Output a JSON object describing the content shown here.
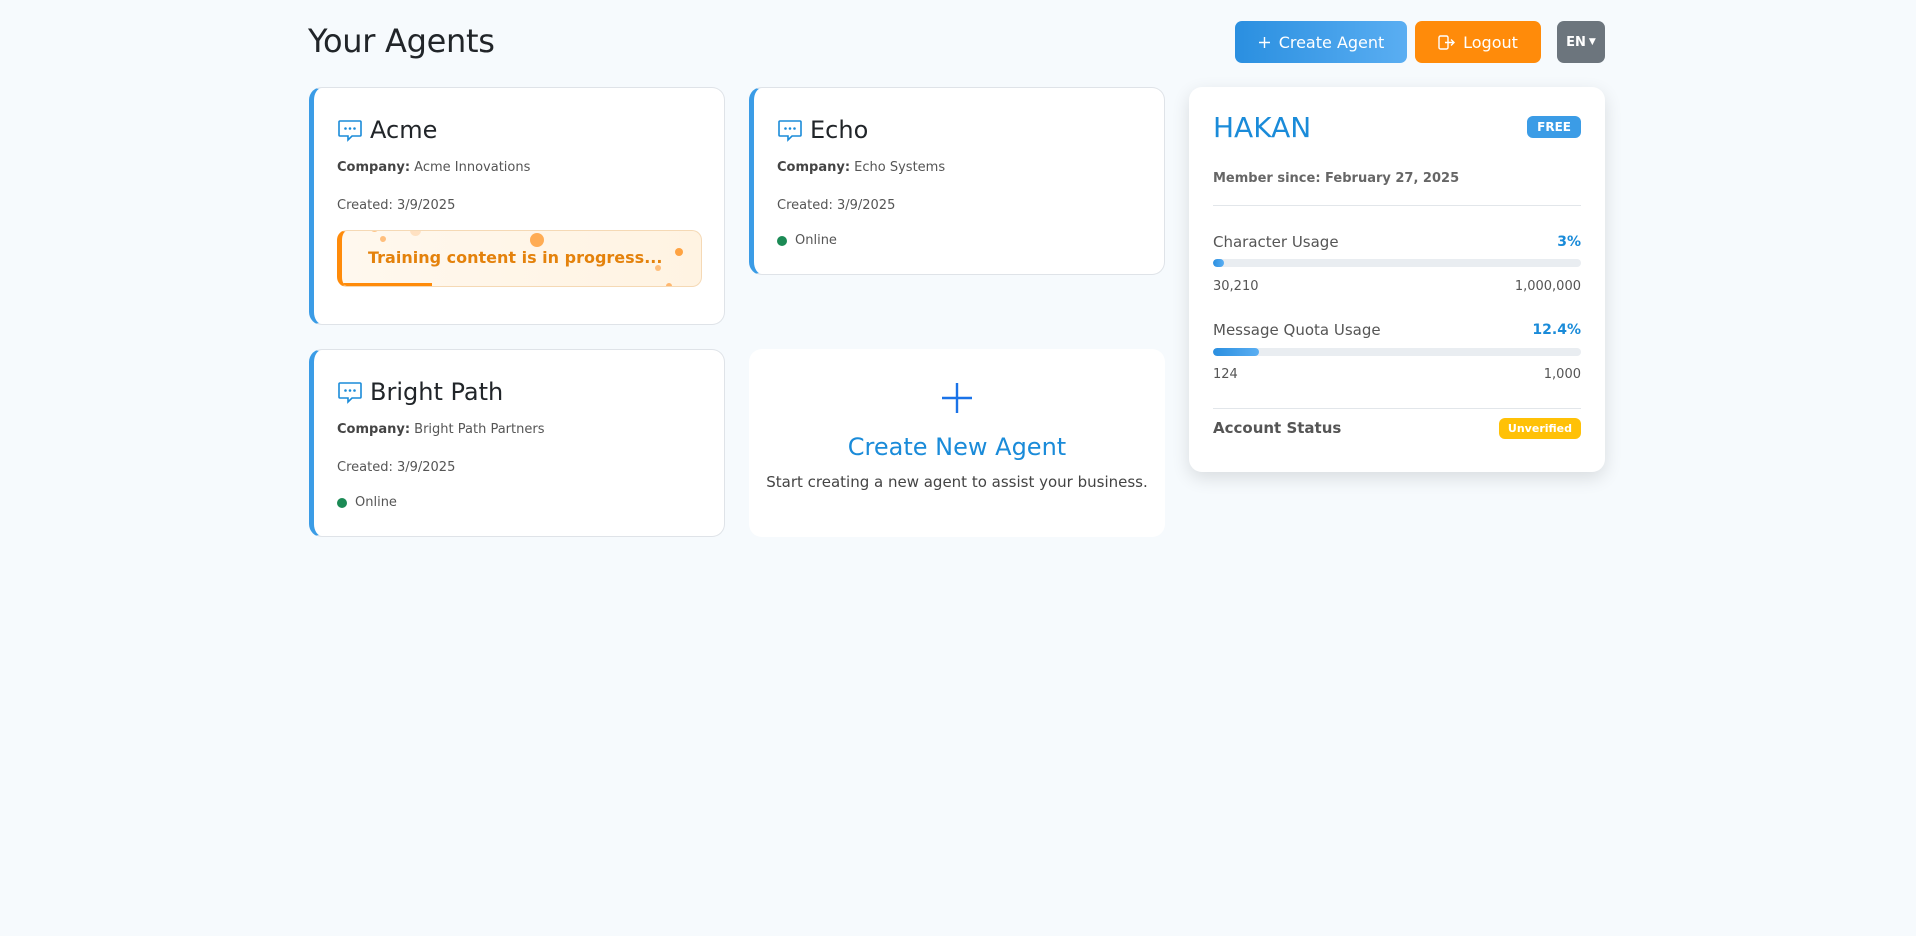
{
  "header": {
    "title": "Your Agents",
    "create_label": "Create Agent",
    "logout_label": "Logout",
    "language": "EN"
  },
  "agents": [
    {
      "name": "Acme",
      "company_label": "Company:",
      "company": "Acme Innovations",
      "created": "Created: 3/9/2025",
      "training_text": "Training content is in progress...",
      "training_progress": 0.25
    },
    {
      "name": "Echo",
      "company_label": "Company:",
      "company": "Echo Systems",
      "created": "Created: 3/9/2025",
      "status": "Online"
    },
    {
      "name": "Bright Path",
      "company_label": "Company:",
      "company": "Bright Path Partners",
      "created": "Created: 3/9/2025",
      "status": "Online"
    }
  ],
  "create_card": {
    "title": "Create New Agent",
    "description": "Start creating a new agent to assist your business."
  },
  "profile": {
    "name": "HAKAN",
    "plan": "FREE",
    "member_since": "Member since: February 27, 2025",
    "character_usage": {
      "label": "Character Usage",
      "percent": "3%",
      "used": "30,210",
      "limit": "1,000,000",
      "fraction": 0.03
    },
    "message_usage": {
      "label": "Message Quota Usage",
      "percent": "12.4%",
      "used": "124",
      "limit": "1,000",
      "fraction": 0.124
    },
    "account_status_label": "Account Status",
    "account_status": "Unverified"
  },
  "colors": {
    "accent": "#1a8bd9",
    "orange": "#ff8b0a",
    "online": "#1b8a55",
    "warning": "#ffc107"
  }
}
